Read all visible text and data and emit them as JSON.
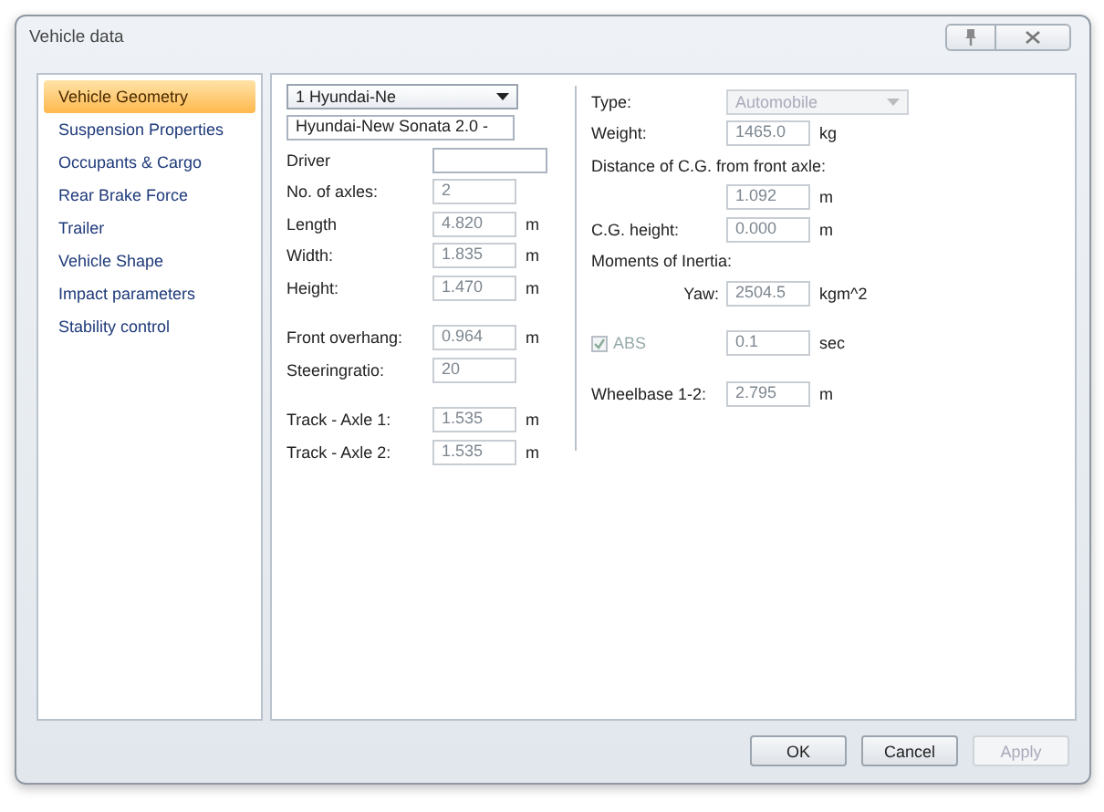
{
  "window": {
    "title": "Vehicle data"
  },
  "sidebar": {
    "items": [
      {
        "label": "Vehicle Geometry",
        "selected": true
      },
      {
        "label": "Suspension Properties",
        "selected": false
      },
      {
        "label": "Occupants & Cargo",
        "selected": false
      },
      {
        "label": "Rear Brake Force",
        "selected": false
      },
      {
        "label": "Trailer",
        "selected": false
      },
      {
        "label": "Vehicle Shape",
        "selected": false
      },
      {
        "label": "Impact parameters",
        "selected": false
      },
      {
        "label": "Stability control",
        "selected": false
      }
    ]
  },
  "left_column": {
    "groups": [
      [
        {
          "kind": "dropdown",
          "value": "1 Hyundai-Ne",
          "disabled": false
        },
        {
          "kind": "wide-field",
          "value": "Hyundai-New Sonata 2.0 -",
          "disabled": false
        },
        {
          "kind": "blank-field",
          "label": "Driver",
          "disabled": false
        },
        {
          "kind": "field",
          "label": "No. of axles:",
          "value": "2",
          "disabled": true
        },
        {
          "kind": "field",
          "label": "Length",
          "value": "4.820",
          "unit": "m",
          "disabled": true
        },
        {
          "kind": "field",
          "label": "Width:",
          "value": "1.835",
          "unit": "m",
          "disabled": true
        },
        {
          "kind": "field",
          "label": "Height:",
          "value": "1.470",
          "unit": "m",
          "disabled": true
        }
      ],
      [
        {
          "kind": "field",
          "label": "Front overhang:",
          "value": "0.964",
          "unit": "m",
          "disabled": true
        },
        {
          "kind": "field",
          "label": "Steeringratio:",
          "value": "20",
          "disabled": true
        }
      ],
      [
        {
          "kind": "field",
          "label": "Track - Axle 1:",
          "value": "1.535",
          "unit": "m",
          "disabled": true
        },
        {
          "kind": "field",
          "label": "Track - Axle 2:",
          "value": "1.535",
          "unit": "m",
          "disabled": true
        }
      ]
    ]
  },
  "right_column": {
    "groups": [
      [
        {
          "kind": "dropdown",
          "label": "Type:",
          "value": "Automobile",
          "disabled": true
        },
        {
          "kind": "field",
          "label": "Weight:",
          "value": "1465.0",
          "unit": "kg",
          "disabled": true
        },
        {
          "kind": "label",
          "label": "Distance of C.G. from front axle:"
        },
        {
          "kind": "field",
          "value": "1.092",
          "unit": "m",
          "disabled": true
        },
        {
          "kind": "field",
          "label": "C.G. height:",
          "value": "0.000",
          "unit": "m",
          "disabled": true
        },
        {
          "kind": "label",
          "label": "Moments of Inertia:"
        },
        {
          "kind": "field-right",
          "label": "Yaw:",
          "value": "2504.5",
          "unit": "kgm^2",
          "disabled": true
        }
      ],
      [
        {
          "kind": "checkbox",
          "label": "ABS",
          "checked": true,
          "disabled": true,
          "value": "0.1",
          "unit": "sec"
        }
      ],
      [
        {
          "kind": "field",
          "label": "Wheelbase 1-2:",
          "value": "2.795",
          "unit": "m",
          "disabled": true
        }
      ]
    ]
  },
  "buttons": [
    {
      "label": "OK",
      "disabled": false
    },
    {
      "label": "Cancel",
      "disabled": false
    },
    {
      "label": "Apply",
      "disabled": true
    }
  ]
}
